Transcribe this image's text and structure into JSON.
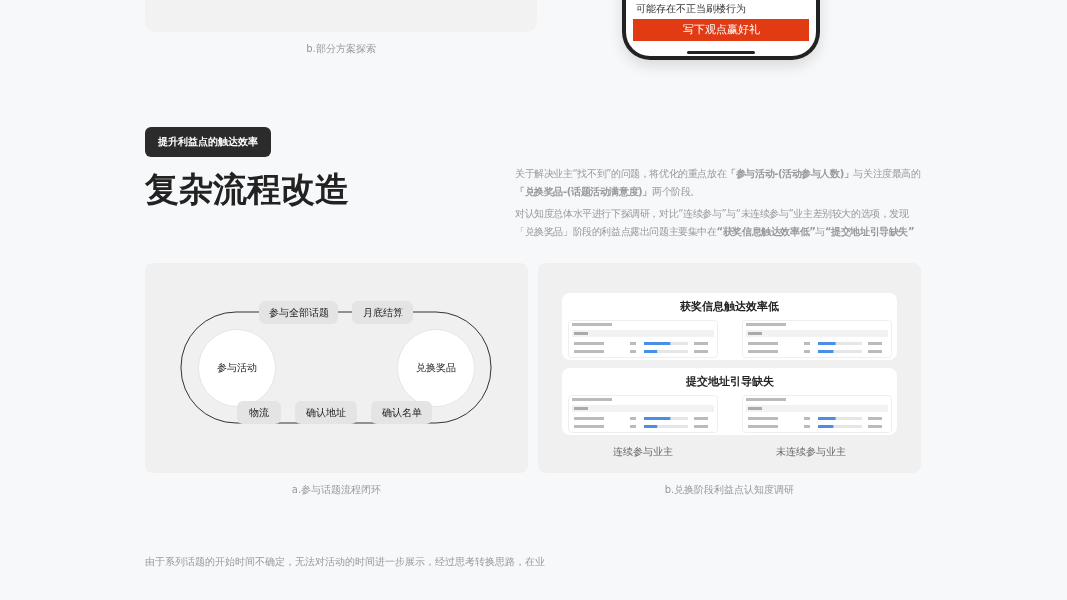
{
  "top_section": {
    "caption": "b.部分方案探索",
    "phone": {
      "text": "可能存在不正当刷楼行为",
      "button": "写下观点赢好礼"
    }
  },
  "section": {
    "tag": "提升利益点的触达效率",
    "title": "复杂流程改造",
    "paragraphs": [
      "关于解决业主“找不到”的问题，将优化的重点放在**「参与活动-(活动参与人数)」**与关注度最高的**「兑换奖品-(话题活动满意度)」**两个阶段。",
      "对认知度总体水平进行下探调研，对比“连续参与”与“未连续参与”业主差别较大的选项，发现「兑换奖品」阶段的利益点露出问题主要集中在**“获奖信息触达效率低”**与**“提交地址引导缺失”**"
    ]
  },
  "figures": [
    {
      "kind": "loop",
      "caption": "a.参与话题流程闭环",
      "nodes": [
        "参与活动",
        "兑换奖品"
      ],
      "top_steps": [
        "参与全部话题",
        "月底结算"
      ],
      "bottom_steps": [
        "物流",
        "确认地址",
        "确认名单"
      ]
    },
    {
      "kind": "survey",
      "caption": "b.兑换阶段利益点认知度调研",
      "panels": [
        "获奖信息触达效率低",
        "提交地址引导缺失"
      ],
      "groups": [
        "连续参与业主",
        "未连续参与业主"
      ]
    }
  ],
  "footer_text": "由于系列话题的开始时间不确定，无法对活动的时间进一步展示，经过思考转换思路，在业"
}
